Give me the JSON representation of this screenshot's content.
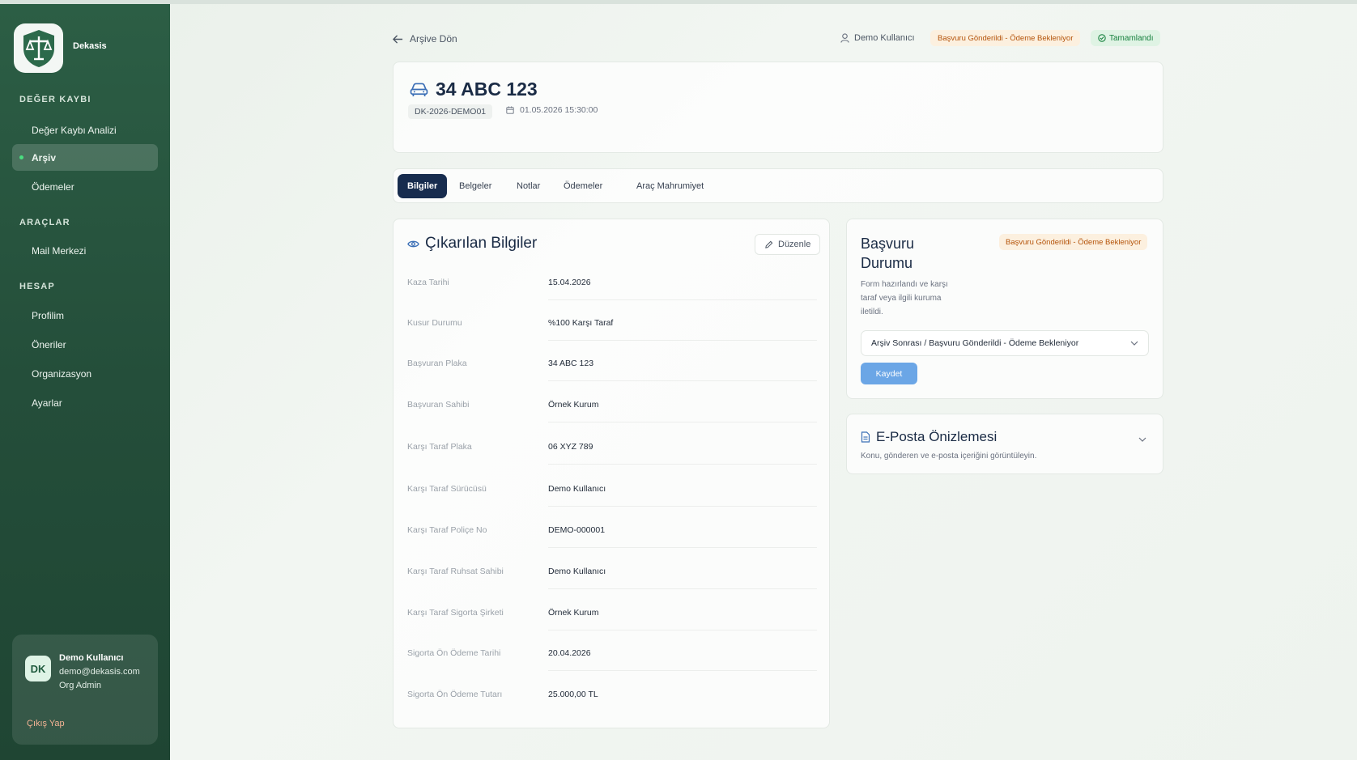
{
  "sidebar": {
    "brand": "Dekasis",
    "sections": {
      "loss": "DEĞER KAYBI",
      "tools": "ARAÇLAR",
      "account": "HESAP"
    },
    "items": [
      {
        "label": "Değer Kaybı Analizi"
      },
      {
        "label": "Arşiv"
      },
      {
        "label": "Ödemeler"
      },
      {
        "label": "Mail Merkezi"
      },
      {
        "label": "Profilim"
      },
      {
        "label": "Öneriler"
      },
      {
        "label": "Organizasyon"
      },
      {
        "label": "Ayarlar"
      }
    ],
    "user": {
      "initials": "DK",
      "name": "Demo Kullanıcı",
      "email": "demo@dekasis.com",
      "role": "Org Admin",
      "logout": "Çıkış Yap"
    }
  },
  "header": {
    "back": "Arşive Dön",
    "user": "Demo Kullanıcı",
    "status_badge": "Başvuru Gönderildi - Ödeme Bekleniyor",
    "done_badge": "Tamamlandı"
  },
  "record": {
    "plate": "34 ABC 123",
    "code": "DK-2026-DEMO01",
    "date": "01.05.2026 15:30:00"
  },
  "tabs": [
    {
      "label": "Bilgiler"
    },
    {
      "label": "Belgeler"
    },
    {
      "label": "Notlar"
    },
    {
      "label": "Ödemeler"
    },
    {
      "label": "Araç Mahrumiyet"
    }
  ],
  "info": {
    "title": "Çıkarılan Bilgiler",
    "edit": "Düzenle",
    "rows": [
      {
        "label": "Kaza Tarihi",
        "value": "15.04.2026"
      },
      {
        "label": "Kusur Durumu",
        "value": "%100 Karşı Taraf"
      },
      {
        "label": "Başvuran Plaka",
        "value": "34 ABC 123"
      },
      {
        "label": "Başvuran Sahibi",
        "value": "Örnek Kurum"
      },
      {
        "label": "Karşı Taraf Plaka",
        "value": "06 XYZ 789"
      },
      {
        "label": "Karşı Taraf Sürücüsü",
        "value": "Demo Kullanıcı"
      },
      {
        "label": "Karşı Taraf Poliçe No",
        "value": "DEMO-000001"
      },
      {
        "label": "Karşı Taraf Ruhsat Sahibi",
        "value": "Demo Kullanıcı"
      },
      {
        "label": "Karşı Taraf Sigorta Şirketi",
        "value": "Örnek Kurum"
      },
      {
        "label": "Sigorta Ön Ödeme Tarihi",
        "value": "20.04.2026"
      },
      {
        "label": "Sigorta Ön Ödeme Tutarı",
        "value": "25.000,00 TL"
      }
    ]
  },
  "status": {
    "title": "Başvuru Durumu",
    "badge": "Başvuru Gönderildi - Ödeme Bekleniyor",
    "description": "Form hazırlandı ve karşı taraf veya ilgili kuruma iletildi.",
    "selected": "Arşiv Sonrası / Başvuru Gönderildi - Ödeme Bekleniyor",
    "save": "Kaydet"
  },
  "email": {
    "title": "E-Posta Önizlemesi",
    "subtitle": "Konu, gönderen ve e-posta içeriğini görüntüleyin."
  },
  "colors": {
    "sidebar": "#2c5e45",
    "accent_navy": "#172c4e",
    "save_blue": "#6ba6e6",
    "warning_bg": "#fcf0df",
    "success_bg": "#dff3e4"
  },
  "icons": [
    "scales-shield-icon",
    "arrow-left-icon",
    "user-icon",
    "check-circle-icon",
    "car-icon",
    "calendar-icon",
    "eye-icon",
    "pencil-icon",
    "chevron-down-icon",
    "document-icon"
  ]
}
